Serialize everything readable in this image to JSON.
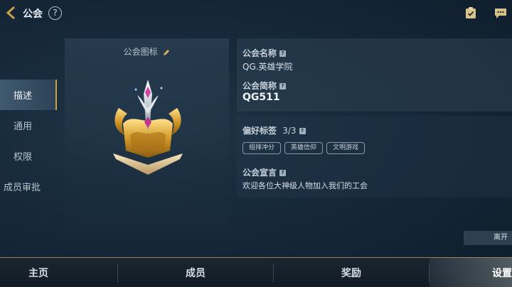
{
  "header": {
    "title": "公会",
    "help_label": "?"
  },
  "nav": {
    "items": [
      {
        "label": "描述",
        "active": true
      },
      {
        "label": "通用",
        "active": false
      },
      {
        "label": "权限",
        "active": false
      },
      {
        "label": "成员审批",
        "active": false
      }
    ]
  },
  "emblem_panel": {
    "title": "公会图标"
  },
  "info": {
    "name_label": "公会名称",
    "name_value": "QG.英雄学院",
    "abbr_label": "公会简称",
    "abbr_value": "QG511",
    "tags_label": "偏好标签",
    "tags_count": "3/3",
    "tags": [
      "组排冲分",
      "英雄信仰",
      "文明游戏"
    ],
    "declaration_label": "公会宣言",
    "declaration_value": "欢迎各位大神级人物加入我们的工会",
    "help_glyph": "?"
  },
  "leave_button": "离开",
  "bottom_tabs": [
    {
      "label": "主页",
      "active": false
    },
    {
      "label": "成员",
      "active": false
    },
    {
      "label": "奖励",
      "active": false
    },
    {
      "label": "设置",
      "active": true
    }
  ],
  "colors": {
    "accent_gold": "#c9a24b",
    "background": "#16283a"
  },
  "icons": [
    "back-chevron-icon",
    "help-circle-icon",
    "checklist-clipboard-icon",
    "chat-bubble-icon",
    "pencil-edit-icon",
    "guild-emblem-icon"
  ]
}
